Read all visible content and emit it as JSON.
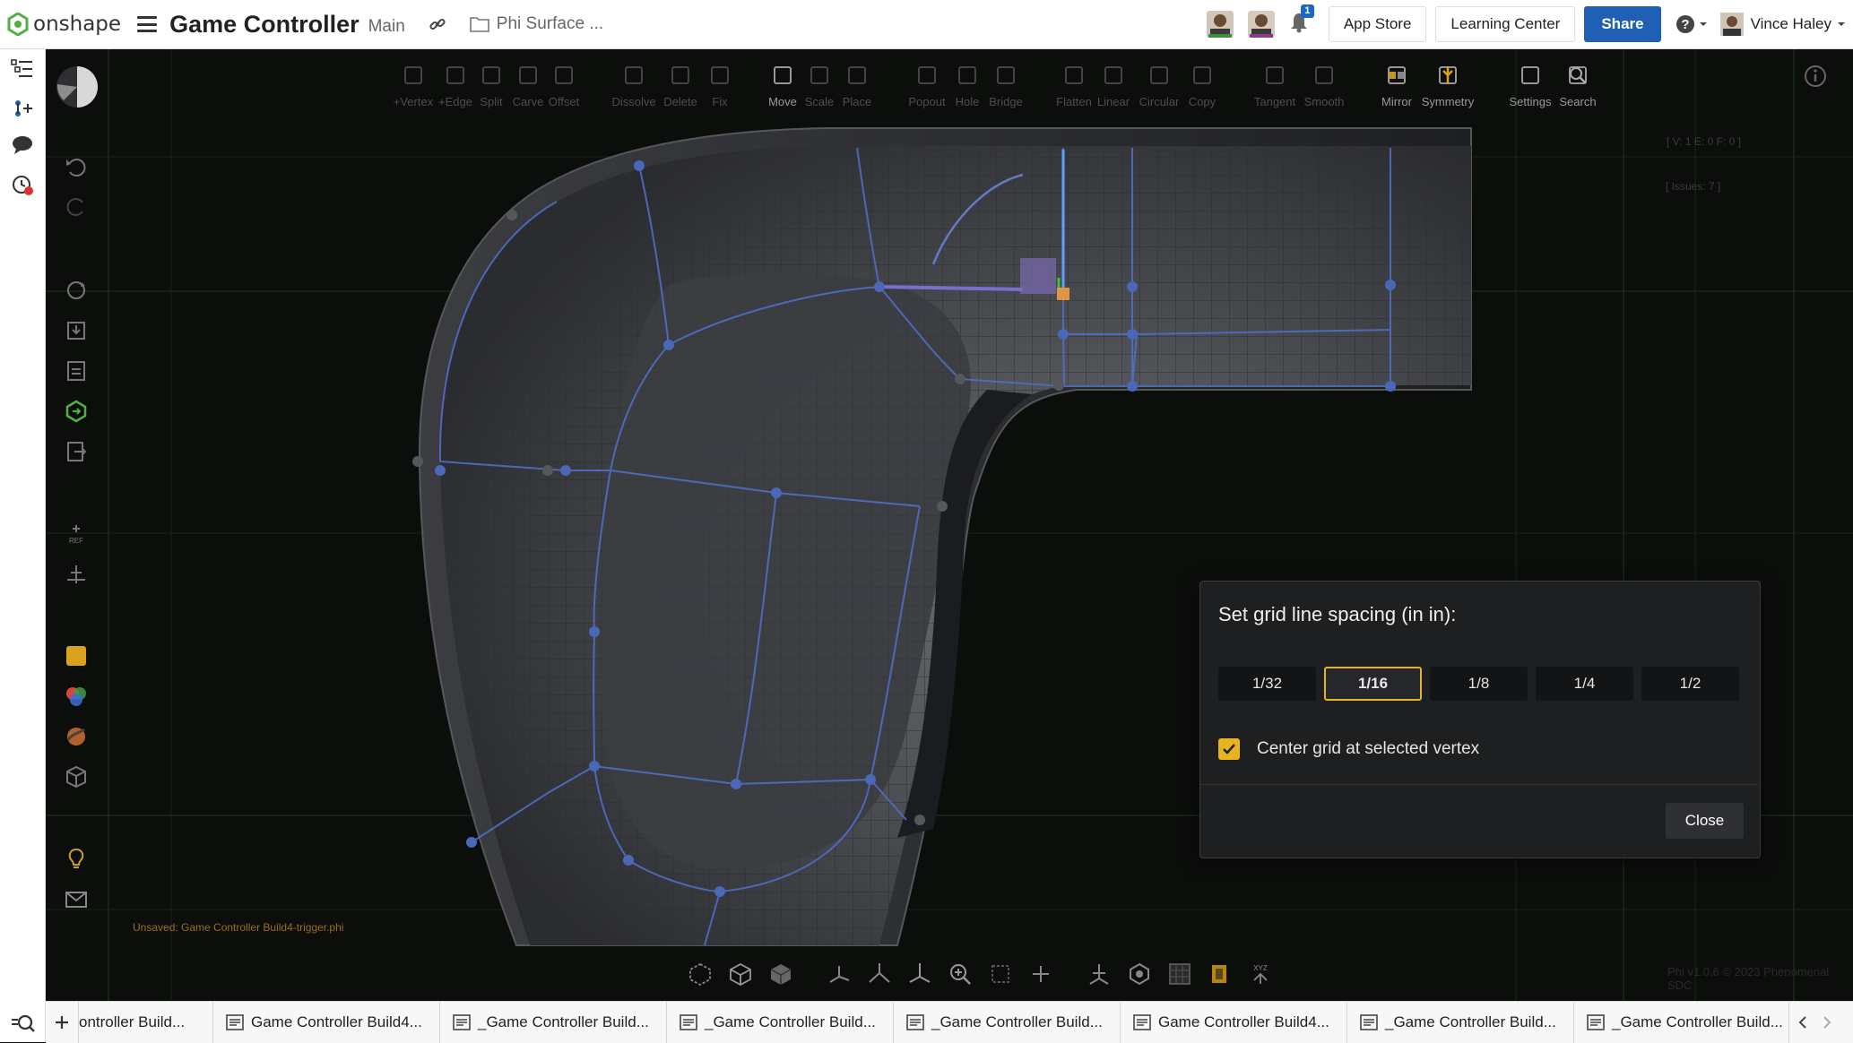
{
  "header": {
    "logo_text": "onshape",
    "doc_title": "Game Controller",
    "branch": "Main",
    "folder": "Phi Surface ...",
    "notification_count": "1",
    "app_store": "App Store",
    "learning_center": "Learning Center",
    "share": "Share",
    "user_name": "Vince Haley"
  },
  "toolbar": [
    {
      "label": "+Vertex"
    },
    {
      "label": "+Edge"
    },
    {
      "label": "Split"
    },
    {
      "label": "Carve"
    },
    {
      "label": "Offset"
    },
    {
      "label": "Dissolve"
    },
    {
      "label": "Delete"
    },
    {
      "label": "Fix"
    },
    {
      "label": "Move"
    },
    {
      "label": "Scale"
    },
    {
      "label": "Place"
    },
    {
      "label": "Popout"
    },
    {
      "label": "Hole"
    },
    {
      "label": "Bridge"
    },
    {
      "label": "Flatten"
    },
    {
      "label": "Linear"
    },
    {
      "label": "Circular"
    },
    {
      "label": "Copy"
    },
    {
      "label": "Tangent"
    },
    {
      "label": "Smooth"
    },
    {
      "label": "Mirror"
    },
    {
      "label": "Symmetry"
    },
    {
      "label": "Settings"
    },
    {
      "label": "Search"
    }
  ],
  "viewport_info": {
    "counts": "[ V: 1 E: 0 F: 0 ]",
    "issues": "[ Issues: 7 ]",
    "unsaved": "Unsaved: Game Controller Build4-trigger.phi",
    "version": "Phi v1.0.6 © 2023 Phenomenal SDC"
  },
  "dialog": {
    "title": "Set grid line spacing (in in):",
    "options": [
      "1/32",
      "1/16",
      "1/8",
      "1/4",
      "1/2"
    ],
    "selected": "1/16",
    "checkbox_label": "Center grid at selected vertex",
    "checkbox_checked": true,
    "close": "Close"
  },
  "tabs": [
    "ontroller Build...",
    "Game Controller Build4...",
    "_Game Controller Build...",
    "_Game Controller Build...",
    "_Game Controller Build...",
    "Game Controller Build4...",
    "_Game Controller Build...",
    "_Game Controller Build..."
  ],
  "colors": {
    "accent_yellow": "#e3b32a",
    "share_blue": "#1f5fb5",
    "mesh_blue": "#4a67b8"
  }
}
